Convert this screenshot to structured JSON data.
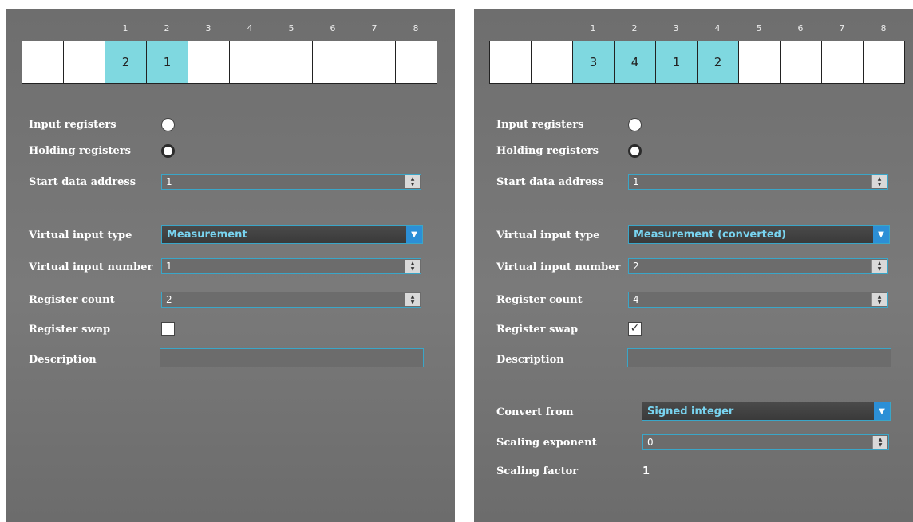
{
  "left_panel": {
    "register_numbers": [
      "",
      "",
      "1",
      "2",
      "3",
      "4",
      "5",
      "6",
      "7",
      "8"
    ],
    "register_cells": [
      "",
      "",
      "2",
      "1",
      "",
      "",
      "",
      "",
      "",
      ""
    ],
    "labels": {
      "input_registers": "Input registers",
      "holding_registers": "Holding registers",
      "start_data_address": "Start data address",
      "virtual_input_type": "Virtual input type",
      "virtual_input_number": "Virtual input number",
      "register_count": "Register count",
      "register_swap": "Register swap",
      "description": "Description"
    },
    "values": {
      "start_data_address": "1",
      "virtual_input_type": "Measurement",
      "virtual_input_number": "1",
      "register_count": "2",
      "register_swap_checked": false,
      "description": ""
    },
    "selected_register_type": "holding"
  },
  "right_panel": {
    "register_numbers": [
      "",
      "",
      "1",
      "2",
      "3",
      "4",
      "5",
      "6",
      "7",
      "8"
    ],
    "register_cells": [
      "",
      "",
      "3",
      "4",
      "1",
      "2",
      "",
      "",
      "",
      ""
    ],
    "labels": {
      "input_registers": "Input registers",
      "holding_registers": "Holding registers",
      "start_data_address": "Start data address",
      "virtual_input_type": "Virtual input type",
      "virtual_input_number": "Virtual input number",
      "register_count": "Register count",
      "register_swap": "Register swap",
      "description": "Description",
      "convert_from": "Convert from",
      "scaling_exponent": "Scaling exponent",
      "scaling_factor": "Scaling factor"
    },
    "values": {
      "start_data_address": "1",
      "virtual_input_type": "Measurement (converted)",
      "virtual_input_number": "2",
      "register_count": "4",
      "register_swap_checked": true,
      "register_swap_mark": "✓",
      "description": "",
      "convert_from": "Signed integer",
      "scaling_exponent": "0",
      "scaling_factor": "1"
    },
    "selected_register_type": "holding"
  },
  "colors": {
    "accent_border": "#3aa6c8",
    "filled_cell": "#7fd8e0",
    "dropdown_text": "#79d4f0",
    "dropdown_button": "#2c8fd6"
  },
  "icons": {
    "spin_up": "▲",
    "spin_down": "▼",
    "dropdown_arrow": "▼"
  }
}
